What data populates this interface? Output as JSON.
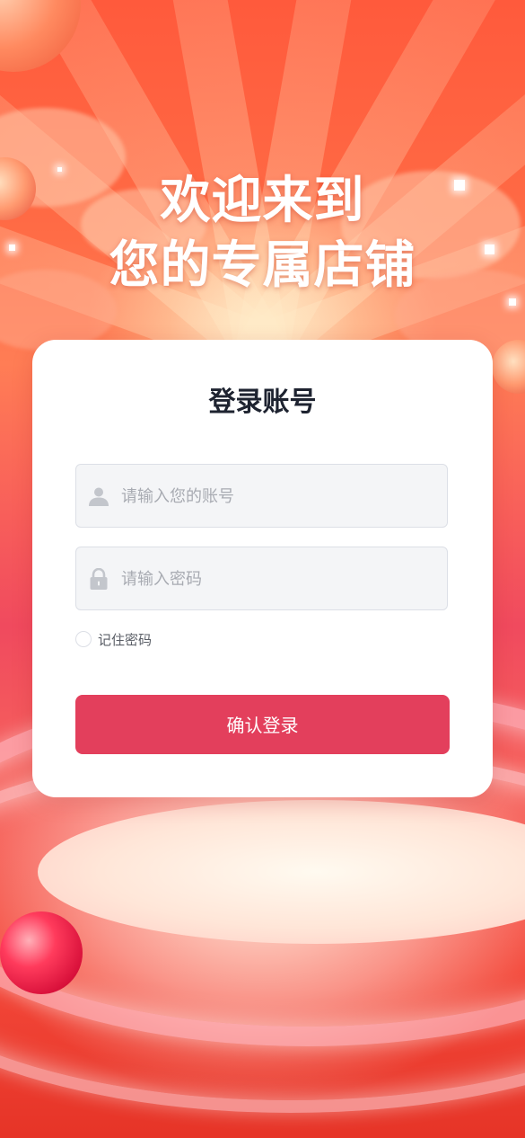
{
  "headline": {
    "line1": "欢迎来到",
    "line2": "您的专属店铺"
  },
  "login_card": {
    "title": "登录账号",
    "account_field": {
      "placeholder": "请输入您的账号",
      "value": "",
      "icon": "user-icon"
    },
    "password_field": {
      "placeholder": "请输入密码",
      "value": "",
      "icon": "lock-icon"
    },
    "remember": {
      "label": "记住密码",
      "checked": false
    },
    "submit_label": "确认登录"
  },
  "colors": {
    "primary_button": "#e33f5c",
    "background_red": "#f24a3a",
    "card": "#ffffff",
    "input_bg": "#f4f5f7",
    "placeholder": "#a8abb2"
  }
}
